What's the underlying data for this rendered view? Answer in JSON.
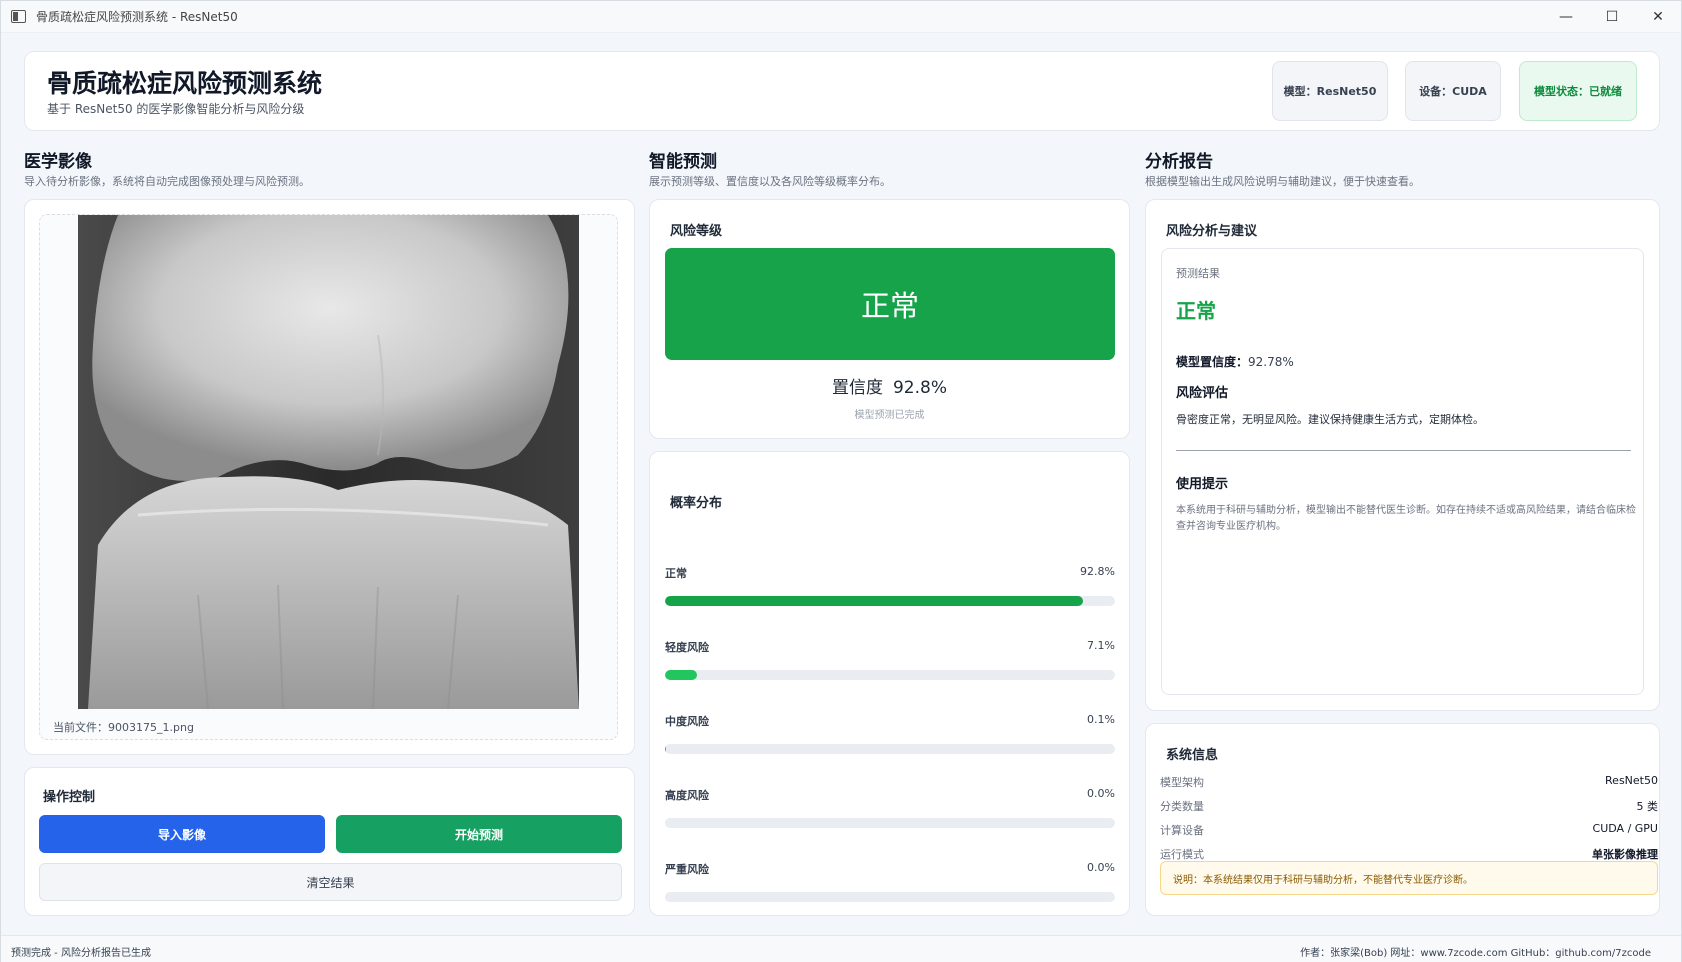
{
  "window": {
    "title": "骨质疏松症风险预测系统 - ResNet50",
    "minimize": "—",
    "maximize": "☐",
    "close": "✕"
  },
  "header": {
    "title": "骨质疏松症风险预测系统",
    "subtitle": "基于 ResNet50 的医学影像智能分析与风险分级",
    "chips": {
      "model": "模型：ResNet50",
      "device": "设备：CUDA",
      "status": "模型状态：已就绪"
    }
  },
  "sections": {
    "image": {
      "title": "医学影像",
      "desc": "导入待分析影像，系统将自动完成图像预处理与风险预测。"
    },
    "predict": {
      "title": "智能预测",
      "desc": "展示预测等级、置信度以及各风险等级概率分布。"
    },
    "report": {
      "title": "分析报告",
      "desc": "根据模型输出生成风险说明与辅助建议，便于快速查看。"
    }
  },
  "image_panel": {
    "current_file": "当前文件：9003175_1.png"
  },
  "controls": {
    "title": "操作控制",
    "import_label": "导入影像",
    "predict_label": "开始预测",
    "clear_label": "清空结果"
  },
  "risk": {
    "title": "风险等级",
    "level": "正常",
    "confidence_label": "置信度",
    "confidence_value": "92.8%",
    "status": "模型预测已完成",
    "color": "#16a34a"
  },
  "probability": {
    "title": "概率分布",
    "items": [
      {
        "label": "正常",
        "value_text": "92.8%",
        "value": 92.8,
        "color": "#16a34a"
      },
      {
        "label": "轻度风险",
        "value_text": "7.1%",
        "value": 7.1,
        "color": "#22c55e"
      },
      {
        "label": "中度风险",
        "value_text": "0.1%",
        "value": 0.1,
        "color": "#22c55e"
      },
      {
        "label": "高度风险",
        "value_text": "0.0%",
        "value": 0.0,
        "color": "#22c55e"
      },
      {
        "label": "严重风险",
        "value_text": "0.0%",
        "value": 0.0,
        "color": "#22c55e"
      }
    ]
  },
  "report": {
    "title": "风险分析与建议",
    "result_label": "预测结果",
    "result": "正常",
    "confidence_key": "模型置信度：",
    "confidence_value": "92.78%",
    "assessment_title": "风险评估",
    "assessment_text": "骨密度正常，无明显风险。建议保持健康生活方式，定期体检。",
    "tips_title": "使用提示",
    "tips_text": "本系统用于科研与辅助分析，模型输出不能替代医生诊断。如存在持续不适或高风险结果，请结合临床检查并咨询专业医疗机构。"
  },
  "system_info": {
    "title": "系统信息",
    "rows": [
      {
        "key": "模型架构",
        "value": "ResNet50"
      },
      {
        "key": "分类数量",
        "value": "5 类"
      },
      {
        "key": "计算设备",
        "value": "CUDA / GPU"
      },
      {
        "key": "运行模式",
        "value": "单张影像推理"
      }
    ],
    "note": "说明：本系统结果仅用于科研与辅助分析，不能替代专业医疗诊断。"
  },
  "statusbar": {
    "left": "预测完成 - 风险分析报告已生成",
    "right": "作者：张家梁(Bob)  网址：www.7zcode.com  GitHub：github.com/7zcode"
  }
}
